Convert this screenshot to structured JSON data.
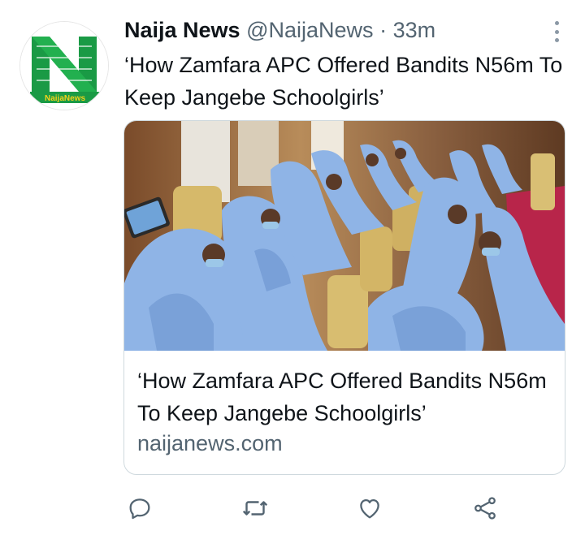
{
  "tweet": {
    "author_name": "Naija News",
    "handle": "@NaijaNews",
    "separator": "·",
    "time": "33m",
    "text": "‘How Zamfara APC Offered Bandits N56m To Keep Jangebe Schoolgirls’",
    "avatar_logo_text": "NaijaNews"
  },
  "card": {
    "title": "‘How Zamfara APC Offered Bandits N56m To Keep Jangebe Schoolgirls’",
    "domain": "naijanews.com"
  },
  "actions": {
    "reply_icon": "reply-icon",
    "retweet_icon": "retweet-icon",
    "like_icon": "heart-icon",
    "share_icon": "share-icon"
  },
  "colors": {
    "brand_green": "#1a9a45",
    "secondary_text": "#536471",
    "icon_gray": "#536471",
    "border": "#cfd9de"
  }
}
